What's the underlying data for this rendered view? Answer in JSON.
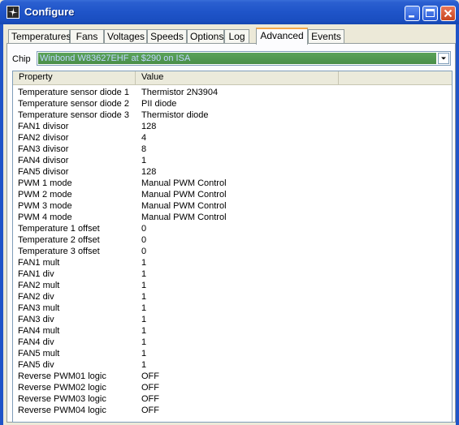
{
  "window": {
    "title": "Configure"
  },
  "tabs": [
    {
      "label": "Temperatures"
    },
    {
      "label": "Fans"
    },
    {
      "label": "Voltages"
    },
    {
      "label": "Speeds"
    },
    {
      "label": "Options"
    },
    {
      "label": "Log"
    },
    {
      "label": "Advanced",
      "active": true
    },
    {
      "label": "Events"
    }
  ],
  "chip": {
    "label": "Chip",
    "value": "Winbond W83627EHF at $290 on ISA"
  },
  "list": {
    "columns": [
      "Property",
      "Value"
    ],
    "rows": [
      {
        "property": "Temperature sensor diode 1",
        "value": "Thermistor 2N3904"
      },
      {
        "property": "Temperature sensor diode 2",
        "value": "PII diode"
      },
      {
        "property": "Temperature sensor diode 3",
        "value": "Thermistor diode"
      },
      {
        "property": "FAN1 divisor",
        "value": "128"
      },
      {
        "property": "FAN2 divisor",
        "value": "4"
      },
      {
        "property": "FAN3 divisor",
        "value": "8"
      },
      {
        "property": "FAN4 divisor",
        "value": "1"
      },
      {
        "property": "FAN5 divisor",
        "value": "128"
      },
      {
        "property": "PWM 1 mode",
        "value": "Manual PWM Control"
      },
      {
        "property": "PWM 2 mode",
        "value": "Manual PWM Control"
      },
      {
        "property": "PWM 3 mode",
        "value": "Manual PWM Control"
      },
      {
        "property": "PWM 4 mode",
        "value": "Manual PWM Control"
      },
      {
        "property": "Temperature 1 offset",
        "value": "0"
      },
      {
        "property": "Temperature 2 offset",
        "value": "0"
      },
      {
        "property": "Temperature 3 offset",
        "value": "0"
      },
      {
        "property": "FAN1 mult",
        "value": "1"
      },
      {
        "property": "FAN1 div",
        "value": "1"
      },
      {
        "property": "FAN2 mult",
        "value": "1"
      },
      {
        "property": "FAN2 div",
        "value": "1"
      },
      {
        "property": "FAN3 mult",
        "value": "1"
      },
      {
        "property": "FAN3 div",
        "value": "1"
      },
      {
        "property": "FAN4 mult",
        "value": "1"
      },
      {
        "property": "FAN4 div",
        "value": "1"
      },
      {
        "property": "FAN5 mult",
        "value": "1"
      },
      {
        "property": "FAN5 div",
        "value": "1"
      },
      {
        "property": "Reverse PWM01 logic",
        "value": "OFF"
      },
      {
        "property": "Reverse PWM02 logic",
        "value": "OFF"
      },
      {
        "property": "Reverse PWM03 logic",
        "value": "OFF"
      },
      {
        "property": "Reverse PWM04 logic",
        "value": "OFF"
      }
    ]
  },
  "icons": {
    "app": "fan-icon",
    "minimize": "minimize-icon",
    "maximize": "maximize-icon",
    "close": "close-icon",
    "dropdown": "chevron-down-icon"
  }
}
